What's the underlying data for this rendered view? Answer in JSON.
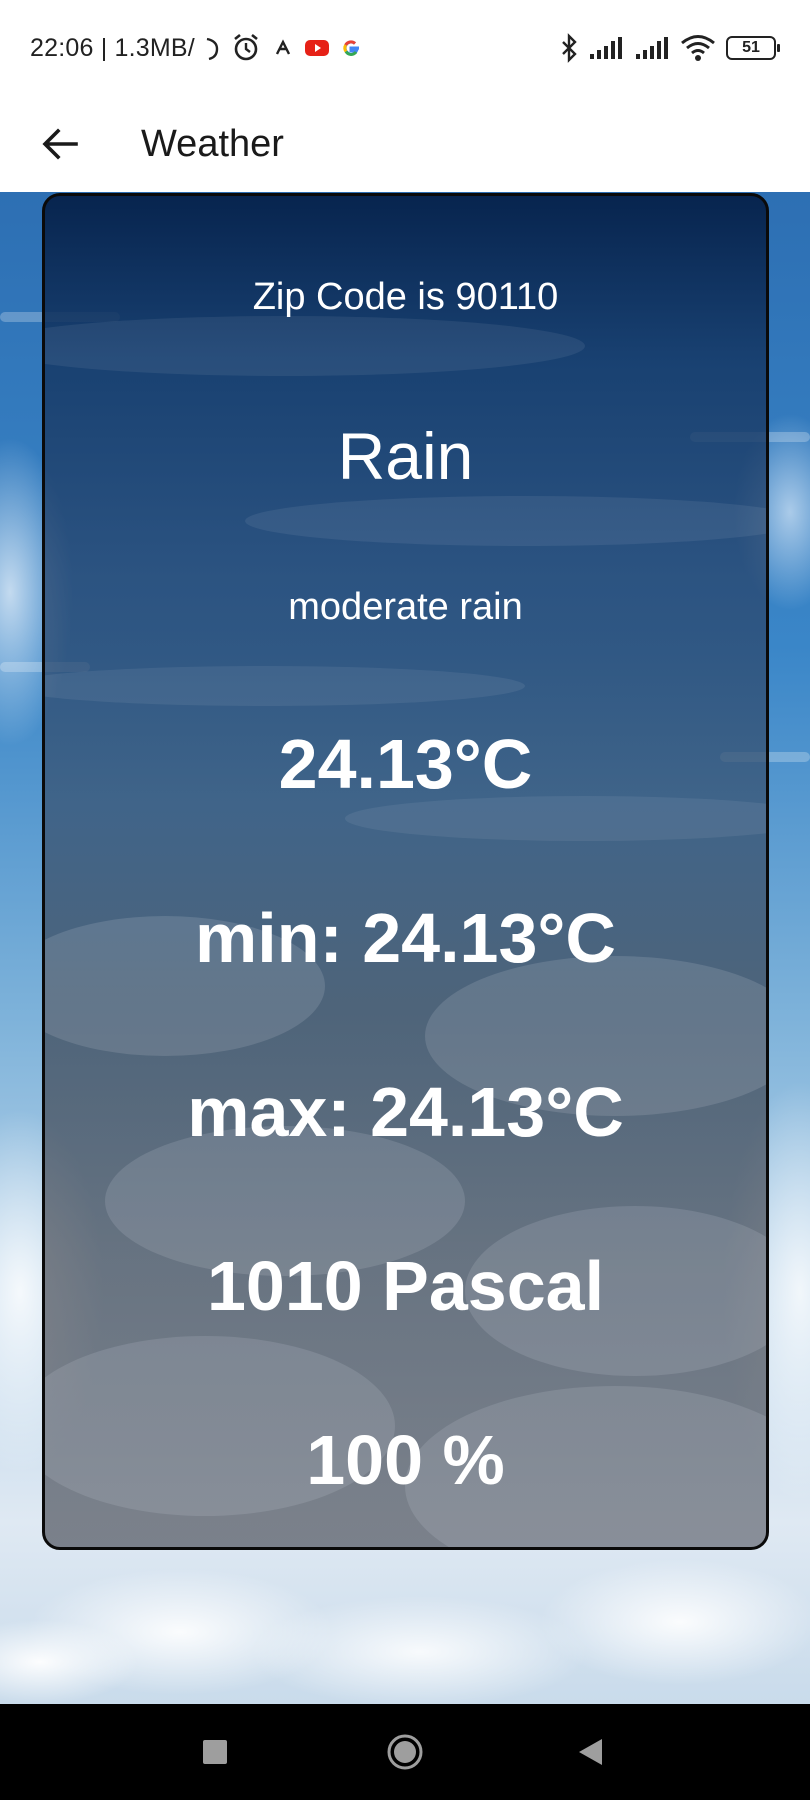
{
  "status_bar": {
    "time": "22:06 | 1.3MB/",
    "battery": "51",
    "icons": [
      "wifi-speed-icon",
      "alarm-icon",
      "app-notification-icon",
      "youtube-icon",
      "google-icon",
      "bluetooth-icon",
      "signal-icon",
      "signal-icon",
      "wifi-icon",
      "battery-icon"
    ]
  },
  "app_bar": {
    "title": "Weather",
    "back_icon": "arrow-left-icon"
  },
  "weather": {
    "zip_text": "Zip Code is 90110",
    "main": "Rain",
    "description": "moderate rain",
    "temperature": "24.13°C",
    "min": "min: 24.13°C",
    "max": "max: 24.13°C",
    "pressure": "1010 Pascal",
    "humidity": "100 %"
  },
  "nav_bar": {
    "icons": [
      "recent-apps-icon",
      "home-icon",
      "back-icon"
    ]
  },
  "colors": {
    "card_border": "#0a0a0a",
    "card_text": "#ffffff",
    "nav_bar": "#000000"
  }
}
